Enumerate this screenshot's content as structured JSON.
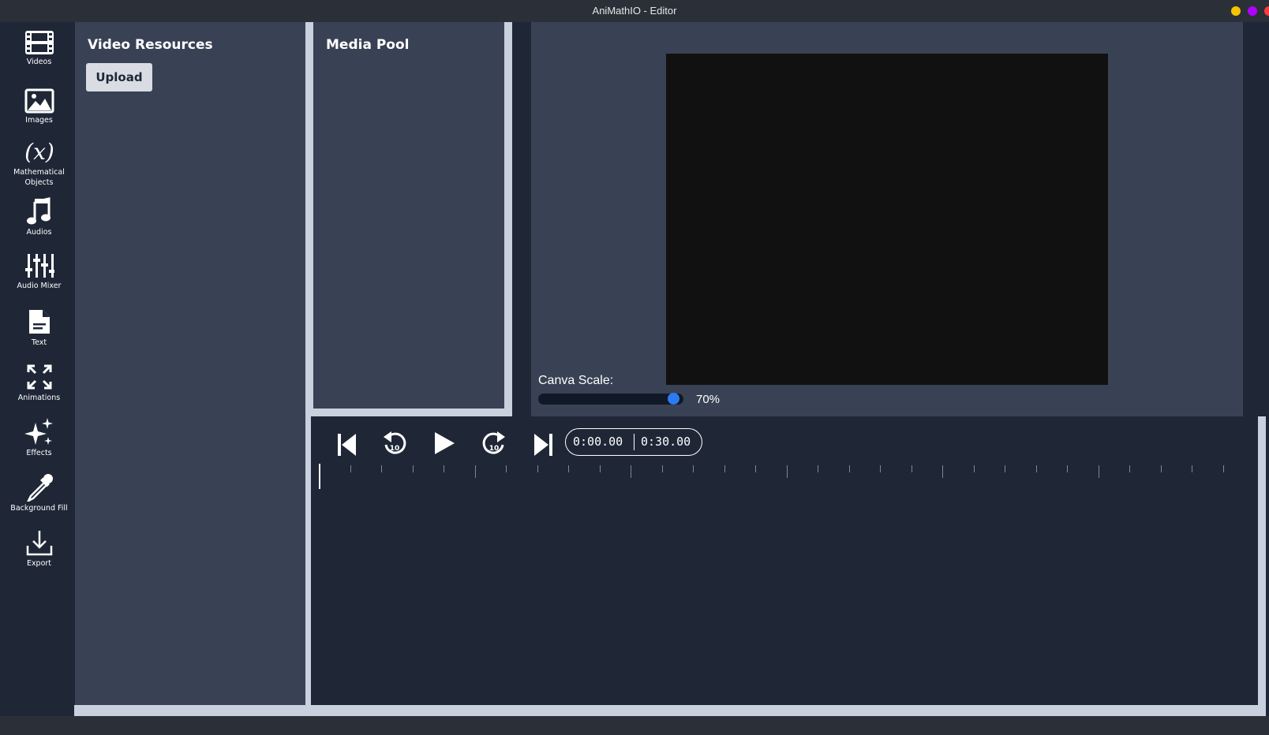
{
  "window": {
    "title": "AniMathIO - Editor",
    "controls": [
      {
        "name": "minimize",
        "color": "#f5c400"
      },
      {
        "name": "maximize",
        "color": "#b000ff"
      },
      {
        "name": "close",
        "color": "#ff3b3b"
      }
    ]
  },
  "sidebar": {
    "items": [
      {
        "label": "Videos",
        "icon": "film-icon"
      },
      {
        "label": "Images",
        "icon": "image-icon"
      },
      {
        "label": "Mathematical Objects",
        "icon": "function-x-icon"
      },
      {
        "label": "Audios",
        "icon": "music-note-icon"
      },
      {
        "label": "Audio Mixer",
        "icon": "mixer-sliders-icon"
      },
      {
        "label": "Text",
        "icon": "document-icon"
      },
      {
        "label": "Animations",
        "icon": "expand-arrows-icon"
      },
      {
        "label": "Effects",
        "icon": "sparkles-icon"
      },
      {
        "label": "Background Fill",
        "icon": "eyedropper-icon"
      },
      {
        "label": "Export",
        "icon": "download-icon"
      }
    ]
  },
  "resources": {
    "title": "Video Resources",
    "upload_label": "Upload"
  },
  "media_pool": {
    "title": "Media Pool"
  },
  "preview": {
    "scale_label": "Canva Scale:",
    "scale_value": "70%",
    "scale_fraction": 0.97,
    "canvas_color": "#111111"
  },
  "player": {
    "current_time": "0:00.00",
    "total_time": "0:30.00",
    "skip_back_seconds": "10",
    "skip_forward_seconds": "10"
  },
  "colors": {
    "panel": "#394254",
    "background": "#1f2737",
    "accent": "#2b7bf2",
    "divider": "#c9d1de"
  }
}
